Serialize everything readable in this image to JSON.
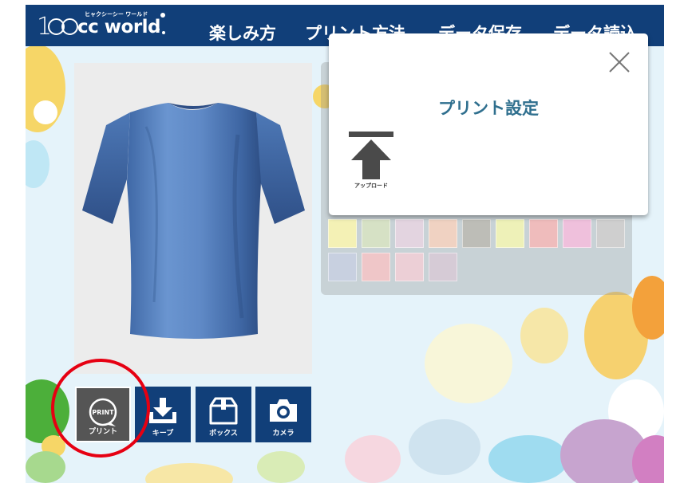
{
  "brand": {
    "number": "100",
    "word": "cc world",
    "kana": "ヒャクシーシー ワールド"
  },
  "nav": [
    {
      "label": "楽しみ方"
    },
    {
      "label": "プリント方法"
    },
    {
      "label": "データ保存"
    },
    {
      "label": "データ読込"
    }
  ],
  "toolbar": [
    {
      "label": "プリント",
      "icon": "print-icon",
      "badge": "PRINT",
      "active": true
    },
    {
      "label": "キープ",
      "icon": "download-icon",
      "active": false
    },
    {
      "label": "ボックス",
      "icon": "box-icon",
      "active": false
    },
    {
      "label": "カメラ",
      "icon": "camera-icon",
      "active": false
    }
  ],
  "color_swatches": [
    "#f4f1b5",
    "#d6e1c5",
    "#e3d4e0",
    "#f0d2c2",
    "#bdbdb7",
    "#eef1b8",
    "#efbcbc",
    "#efc0dc",
    "#cfcfcf",
    "#c8d0e0",
    "#efc6c8",
    "#eccfd6",
    "#d6cbd6"
  ],
  "dialog": {
    "title": "プリント設定",
    "upload_label": "アップロード",
    "close_icon": "close-icon"
  },
  "product": {
    "item": "t-shirt",
    "color": "#5b86c4"
  },
  "colors": {
    "nav_bg": "#113f79",
    "highlight_ring": "#e60012",
    "title_text": "#2f6f8e",
    "active_button": "#555555"
  }
}
